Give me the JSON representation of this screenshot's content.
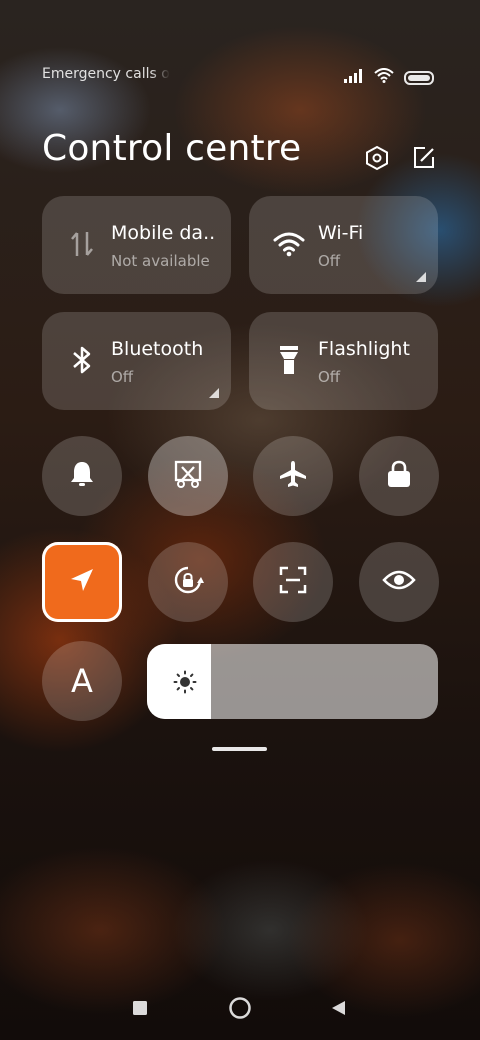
{
  "status_bar": {
    "carrier_text": "Emergency calls o",
    "icons": [
      "signal-icon",
      "wifi-icon",
      "battery-icon"
    ]
  },
  "header": {
    "title": "Control centre",
    "icons": [
      "settings-icon",
      "edit-icon"
    ]
  },
  "tiles": [
    {
      "name": "Mobile da..",
      "state": "Not available",
      "icon": "mobile-data-icon",
      "has_arrow": false
    },
    {
      "name": "Wi-Fi",
      "state": "Off",
      "icon": "wifi-icon",
      "has_arrow": true
    },
    {
      "name": "Bluetooth",
      "state": "Off",
      "icon": "bluetooth-icon",
      "has_arrow": true
    },
    {
      "name": "Flashlight",
      "state": "Off",
      "icon": "flashlight-icon",
      "has_arrow": false
    }
  ],
  "toggles_row1": [
    "bell-icon",
    "screenshot-icon",
    "airplane-icon",
    "lock-icon"
  ],
  "toggles_row2": [
    "location-icon",
    "rotation-lock-icon",
    "scanner-icon",
    "eye-icon"
  ],
  "font_toggle": {
    "label": "A"
  },
  "brightness": {
    "level": 0.22,
    "icon": "brightness-icon"
  },
  "nav_bar": [
    "recents-icon",
    "home-icon",
    "back-icon"
  ],
  "colors": {
    "accent": "#f06a1c",
    "tile_bg": "rgba(255,255,255,0.16)"
  }
}
